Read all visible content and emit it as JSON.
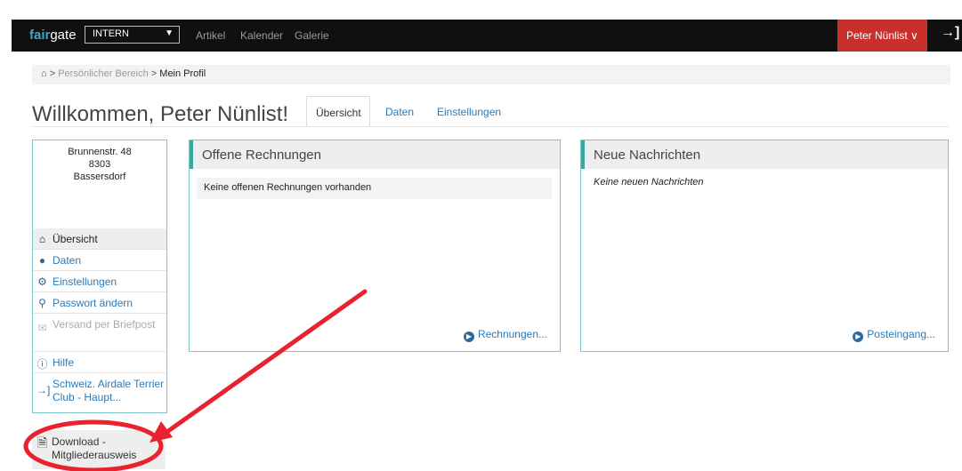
{
  "topbar": {
    "logo_fair": "fair",
    "logo_gate": "gate",
    "context_select": "INTERN",
    "nav": [
      "Artikel",
      "Kalender",
      "Galerie"
    ],
    "user_name": "Peter Nünlist ∨"
  },
  "breadcrumb": {
    "separator": ">",
    "items": [
      "Persönlicher Bereich",
      "Mein Profil"
    ]
  },
  "page": {
    "title": "Willkommen, Peter Nünlist!",
    "tabs": [
      "Übersicht",
      "Daten",
      "Einstellungen"
    ]
  },
  "sidebar": {
    "address": [
      "Brunnenstr. 48",
      "8303",
      "Bassersdorf"
    ],
    "items": [
      {
        "label": "Übersicht",
        "icon": "home-icon"
      },
      {
        "label": "Daten",
        "icon": "user-icon"
      },
      {
        "label": "Einstellungen",
        "icon": "gear-icon"
      },
      {
        "label": "Passwort ändern",
        "icon": "key-icon"
      },
      {
        "label": "Versand per Briefpost",
        "icon": "envelope-icon"
      },
      {
        "label": "Hilfe",
        "icon": "info-icon"
      },
      {
        "label": "Schweiz. Airdale Terrier Club - Haupt...",
        "icon": "sign-in-icon"
      }
    ],
    "download": "Download - Mitgliederausweis"
  },
  "rechnungen": {
    "title": "Offene Rechnungen",
    "empty": "Keine offenen Rechnungen vorhanden",
    "link": "Rechnungen..."
  },
  "nachrichten": {
    "title": "Neue Nachrichten",
    "empty": "Keine neuen Nachrichten",
    "link": "Posteingang..."
  },
  "colors": {
    "topbar": "#101010",
    "user_button": "#c9302c",
    "panel_border": "#7ec7c9",
    "annotation": "#e8222e"
  }
}
